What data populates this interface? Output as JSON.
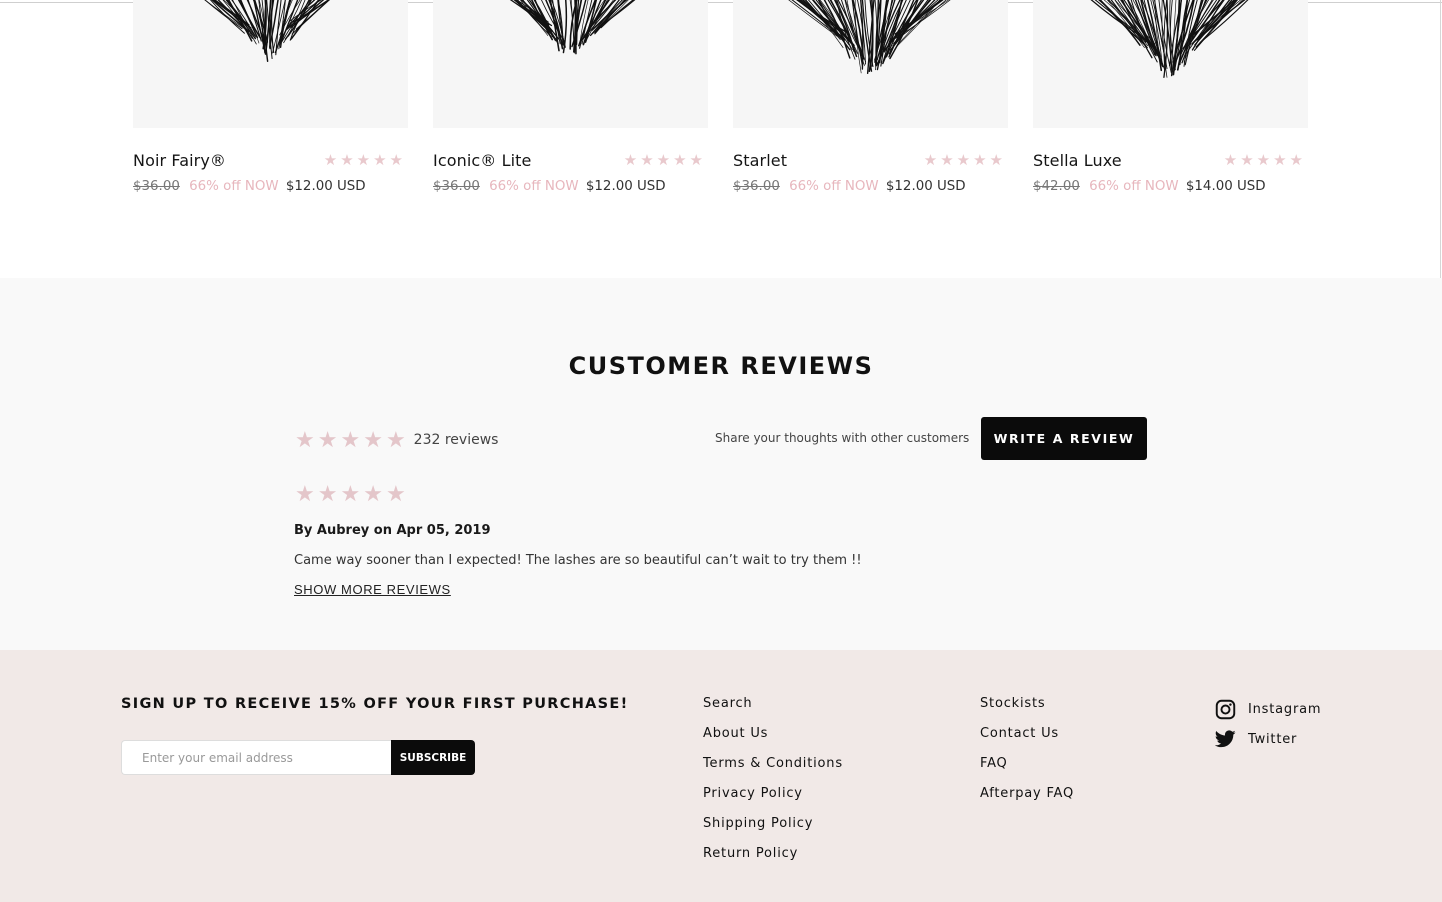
{
  "products": [
    {
      "name": "Noir Fairy®",
      "old_price": "$36.00",
      "discount": "66% off NOW",
      "price": "$12.00 USD",
      "rating": 5
    },
    {
      "name": "Iconic® Lite",
      "old_price": "$36.00",
      "discount": "66% off NOW",
      "price": "$12.00 USD",
      "rating": 5
    },
    {
      "name": "Starlet",
      "old_price": "$36.00",
      "discount": "66% off NOW",
      "price": "$12.00 USD",
      "rating": 5
    },
    {
      "name": "Stella Luxe",
      "old_price": "$42.00",
      "discount": "66% off NOW",
      "price": "$14.00 USD",
      "rating": 5
    }
  ],
  "reviews": {
    "title": "CUSTOMER REVIEWS",
    "count_label": "232 reviews",
    "average_rating": 5,
    "share_text": "Share your thoughts with other customers",
    "write_button": "WRITE A REVIEW",
    "items": [
      {
        "rating": 5,
        "author_line": "By Aubrey on Apr 05, 2019",
        "body": "Came way sooner than I expected! The lashes are so beautiful can’t wait to try them !!"
      }
    ],
    "show_more": "SHOW MORE REVIEWS"
  },
  "footer": {
    "signup_title": "SIGN UP TO RECEIVE 15% OFF YOUR FIRST PURCHASE!",
    "email_placeholder": "Enter your email address",
    "subscribe_label": "SUBSCRIBE",
    "links_col1": [
      "Search",
      "About Us",
      "Terms & Conditions",
      "Privacy Policy",
      "Shipping Policy",
      "Return Policy"
    ],
    "links_col2": [
      "Stockists",
      "Contact Us",
      "FAQ",
      "Afterpay FAQ"
    ],
    "social": [
      {
        "label": "Instagram",
        "icon": "instagram-icon"
      },
      {
        "label": "Twitter",
        "icon": "twitter-icon"
      }
    ]
  },
  "colors": {
    "star": "#e4c6ca",
    "discount": "#e7b6bd",
    "footer_bg": "#f1e9e7",
    "button_bg": "#0b0b0b"
  }
}
